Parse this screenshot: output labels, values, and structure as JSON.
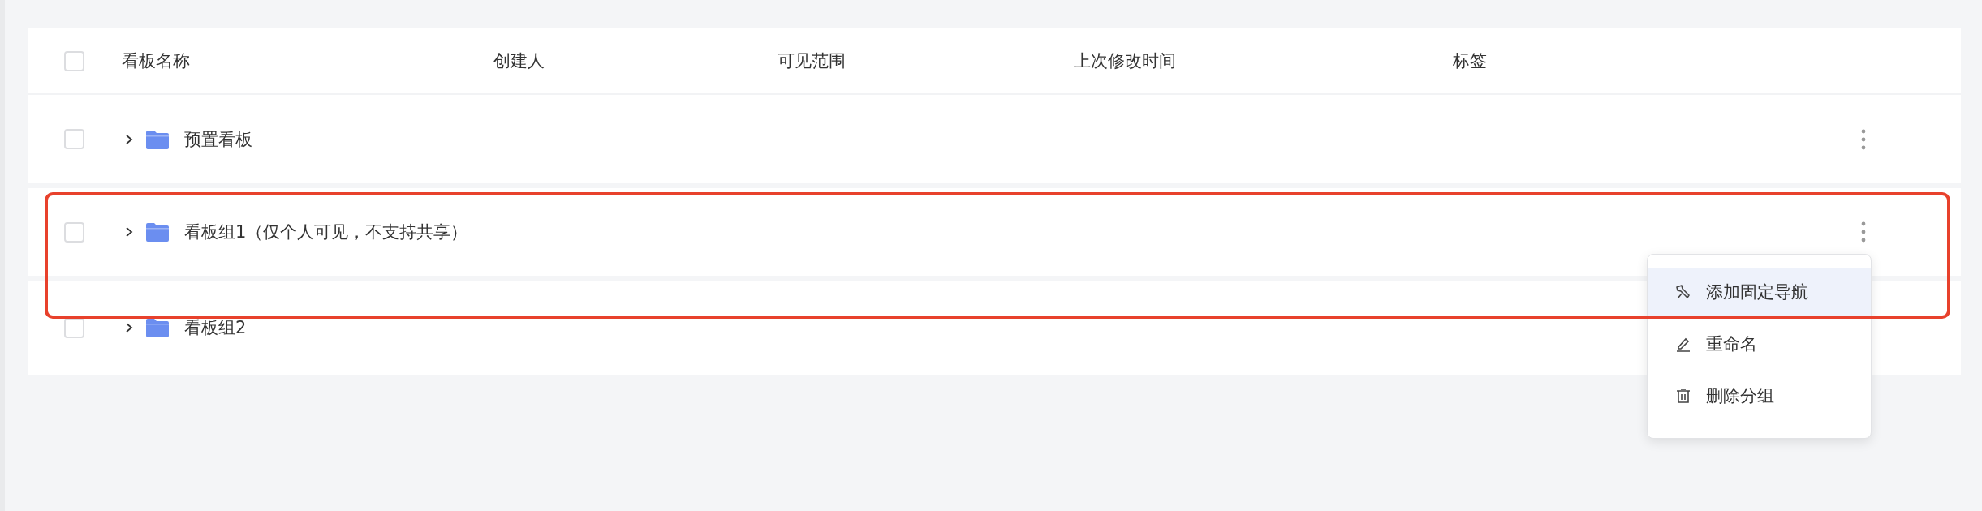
{
  "table": {
    "header_checked": false,
    "columns": [
      "看板名称",
      "创建人",
      "可见范围",
      "上次修改时间",
      "标签"
    ],
    "rows": [
      {
        "name": "预置看板",
        "checked": false,
        "expanded": false,
        "annotated": false
      },
      {
        "name": "看板组1（仅个人可见，不支持共享）",
        "checked": false,
        "expanded": false,
        "annotated": true
      },
      {
        "name": "看板组2",
        "checked": false,
        "expanded": false,
        "annotated": false
      }
    ]
  },
  "context_menu": {
    "items": [
      {
        "kind": "pin",
        "label": "添加固定导航",
        "selected": true
      },
      {
        "kind": "rename",
        "label": "重命名",
        "selected": false
      },
      {
        "kind": "delete",
        "label": "删除分组",
        "selected": false
      }
    ]
  }
}
